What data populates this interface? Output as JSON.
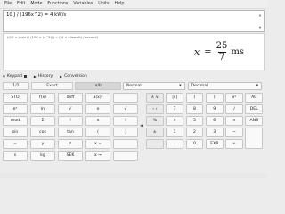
{
  "menu": [
    "File",
    "Edit",
    "Mode",
    "Functions",
    "Variables",
    "Units",
    "Help"
  ],
  "input": {
    "expression": "10 J / (196x^2) = 4 kW/s"
  },
  "result": {
    "parsed": "((10 × joule) / (196 × (x^2))) = ((4 × kilowatt) / second)",
    "variable": "x",
    "equals": "=",
    "numerator": "25",
    "denominator": "7",
    "unit": "ms"
  },
  "tabs": {
    "keypad": "Keypad",
    "history": "History",
    "conversion": "Conversion"
  },
  "keypad_bar": {
    "mode": "1/2",
    "exact": "Exact",
    "fraction": "a/b",
    "format": "Normal",
    "base": "Decimal"
  },
  "keys_left": [
    [
      "STO",
      "f(x)",
      "0xff",
      "a(x)²",
      ""
    ],
    [
      "eˣ",
      "ln",
      "√",
      "e",
      "√"
    ],
    [
      "mod",
      "Σ",
      "!",
      "π",
      "i"
    ],
    [
      "sin",
      "cos",
      "tan",
      "(",
      ")"
    ],
    [
      "=",
      "y",
      "z",
      "x =",
      ""
    ],
    [
      "s",
      "kg",
      "SEK",
      "x →",
      ""
    ]
  ],
  "keys_right": [
    [
      "∧ ∨",
      "|x|",
      "(",
      ")",
      "xʸ",
      "AC"
    ],
    [
      "‹ ›",
      "7",
      "8",
      "9",
      "/",
      "DEL"
    ],
    [
      "%",
      "4",
      "5",
      "6",
      "×",
      "ANS"
    ],
    [
      "±",
      "1",
      "2",
      "3",
      "−",
      ""
    ],
    [
      "",
      ".",
      "0",
      "EXP",
      "+",
      ""
    ]
  ]
}
